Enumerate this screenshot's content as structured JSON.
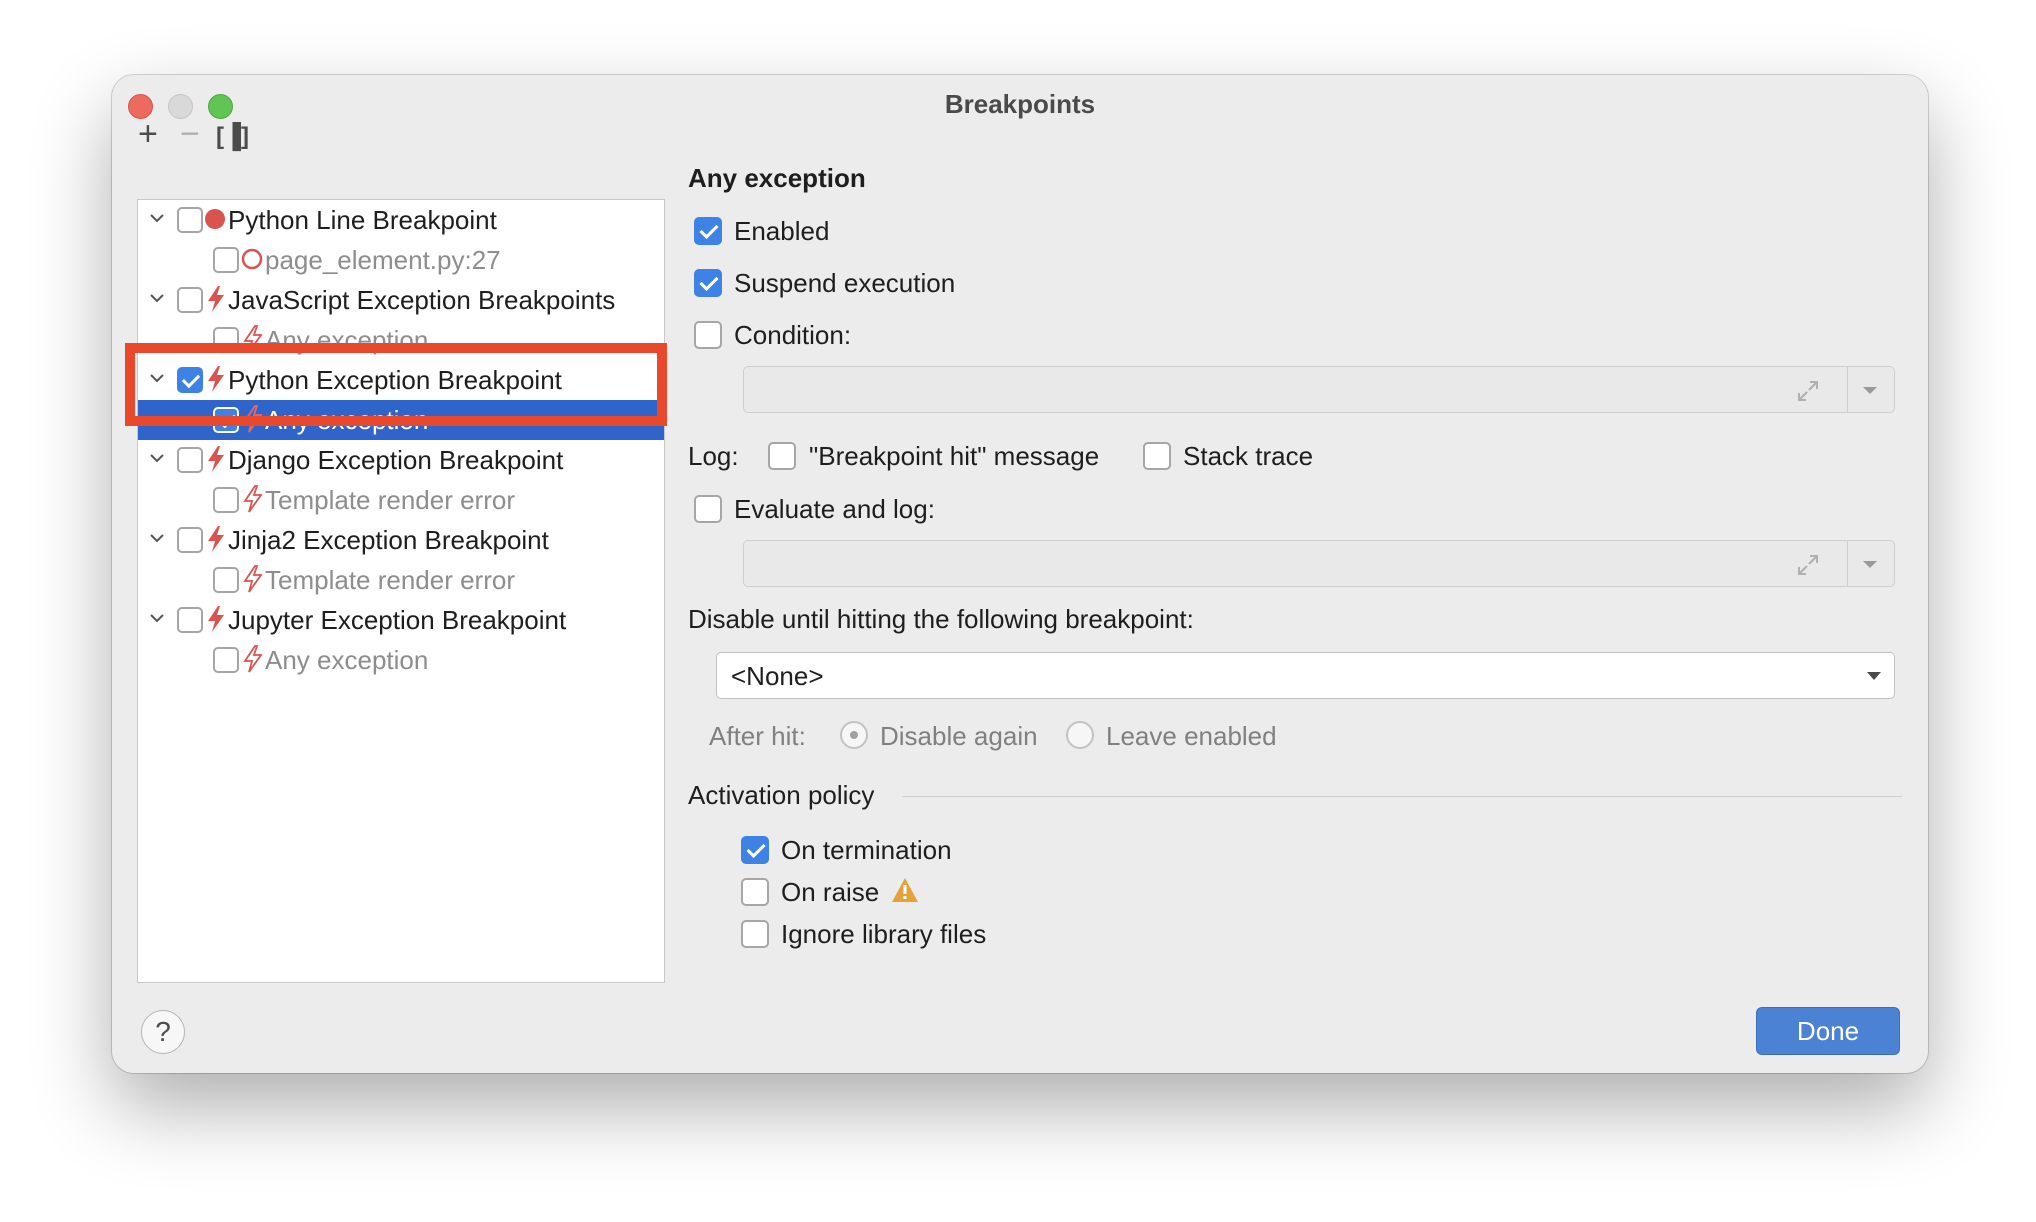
{
  "window": {
    "title": "Breakpoints"
  },
  "toolbar": {
    "add_icon": "+",
    "remove_icon": "−",
    "group_icon": "[▐]"
  },
  "tree": {
    "items": [
      {
        "label": "Python Line Breakpoint",
        "checked": false,
        "icon": "red-dot-icon",
        "dim": false
      },
      {
        "label": "page_element.py:27",
        "checked": false,
        "icon": "red-circle-outline-icon",
        "dim": true
      },
      {
        "label": "JavaScript Exception Breakpoints",
        "checked": false,
        "icon": "lightning-icon",
        "dim": false
      },
      {
        "label": "Any exception",
        "checked": false,
        "icon": "lightning-icon",
        "dim": true
      },
      {
        "label": "Python Exception Breakpoint",
        "checked": true,
        "icon": "lightning-icon",
        "dim": false
      },
      {
        "label": "Any exception",
        "checked": true,
        "icon": "lightning-icon",
        "dim": false,
        "selected": true
      },
      {
        "label": "Django Exception Breakpoint",
        "checked": false,
        "icon": "lightning-icon",
        "dim": false
      },
      {
        "label": "Template render error",
        "checked": false,
        "icon": "lightning-icon",
        "dim": true
      },
      {
        "label": "Jinja2 Exception Breakpoint",
        "checked": false,
        "icon": "lightning-icon",
        "dim": false
      },
      {
        "label": "Template render error",
        "checked": false,
        "icon": "lightning-icon",
        "dim": true
      },
      {
        "label": "Jupyter Exception Breakpoint",
        "checked": false,
        "icon": "lightning-icon",
        "dim": false
      },
      {
        "label": "Any exception",
        "checked": false,
        "icon": "lightning-icon",
        "dim": true
      }
    ]
  },
  "details": {
    "heading": "Any exception",
    "enabled": {
      "label": "Enabled",
      "checked": true
    },
    "suspend": {
      "label": "Suspend execution",
      "checked": true
    },
    "condition": {
      "label": "Condition:",
      "checked": false,
      "value": ""
    },
    "log_label": "Log:",
    "log_message": {
      "label": "\"Breakpoint hit\" message",
      "checked": false
    },
    "log_stack": {
      "label": "Stack trace",
      "checked": false
    },
    "evaluate": {
      "label": "Evaluate and log:",
      "checked": false,
      "value": ""
    },
    "disable_until": {
      "label": "Disable until hitting the following breakpoint:",
      "value": "<None>"
    },
    "after_hit": {
      "label": "After hit:",
      "disable_again": "Disable again",
      "leave_enabled": "Leave enabled",
      "selected": "disable_again"
    },
    "activation": {
      "title": "Activation policy",
      "on_termination": {
        "label": "On termination",
        "checked": true
      },
      "on_raise": {
        "label": "On raise",
        "checked": false,
        "warning_icon": "warning-icon"
      },
      "ignore_library": {
        "label": "Ignore library files",
        "checked": false
      }
    }
  },
  "footer": {
    "help": "?",
    "done": "Done"
  },
  "colors": {
    "selection": "#2f65ca",
    "accent": "#3e82e5",
    "breakpoint_red": "#d9534f",
    "annotation_box": "#e8492c",
    "done_button": "#4b82d4"
  }
}
